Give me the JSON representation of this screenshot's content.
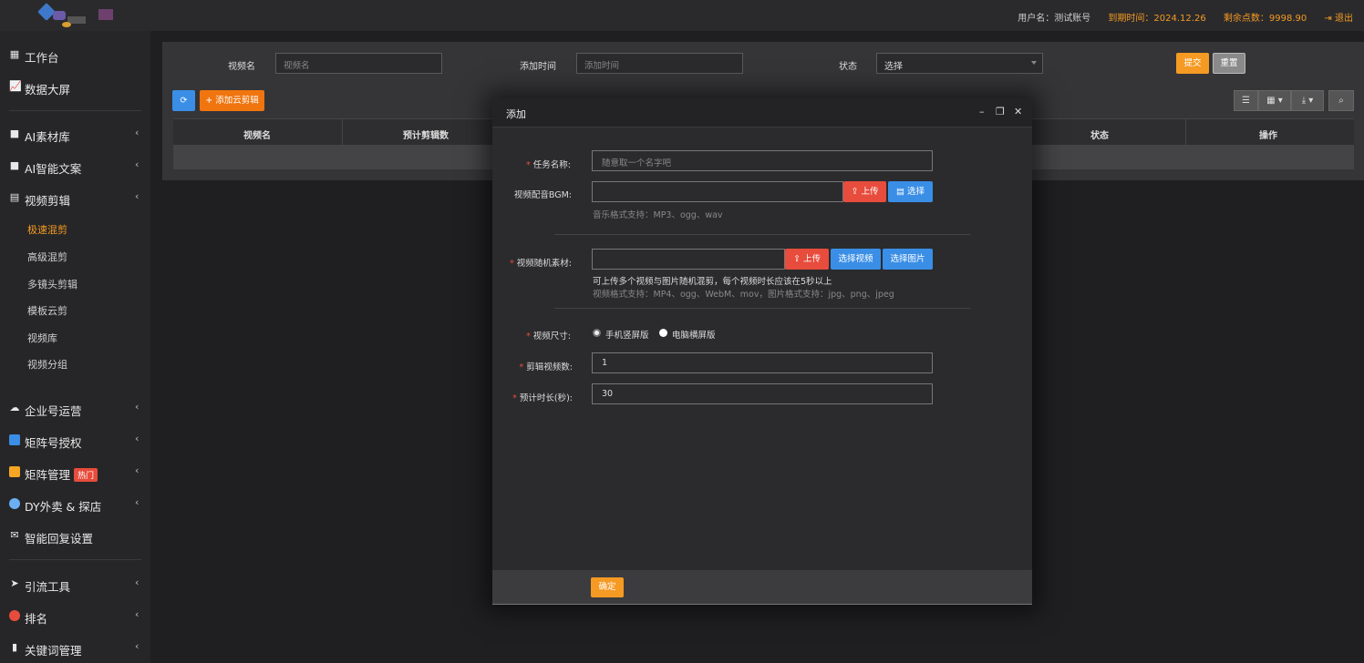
{
  "header": {
    "username_label": "用户名：测试账号",
    "expiry_label": "到期时间：2024.12.26",
    "points_label": "剩余点数：9998.90",
    "logout_label": "退出"
  },
  "sidebar": {
    "items": [
      {
        "label": "工作台"
      },
      {
        "label": "数据大屏"
      },
      {
        "label": "AI素材库"
      },
      {
        "label": "AI智能文案"
      },
      {
        "label": "视频剪辑"
      },
      {
        "label": "企业号运营"
      },
      {
        "label": "矩阵号授权"
      },
      {
        "label": "矩阵管理",
        "badge": "热门"
      },
      {
        "label": "DY外卖 & 探店"
      },
      {
        "label": "智能回复设置"
      },
      {
        "label": "引流工具"
      },
      {
        "label": "排名"
      },
      {
        "label": "关键词管理"
      }
    ],
    "sub_items": [
      {
        "label": "极速混剪"
      },
      {
        "label": "高级混剪"
      },
      {
        "label": "多镜头剪辑"
      },
      {
        "label": "模板云剪"
      },
      {
        "label": "视频库"
      },
      {
        "label": "视频分组"
      }
    ]
  },
  "filter": {
    "video_name_label": "视频名",
    "video_name_placeholder": "视频名",
    "add_time_label": "添加时间",
    "add_time_placeholder": "添加时间",
    "status_label": "状态",
    "status_value": "选择",
    "submit_label": "提交",
    "reset_label": "重置"
  },
  "toolbar": {
    "add_label": "添加云剪辑"
  },
  "table": {
    "columns": [
      "视频名",
      "预计剪辑数",
      "状态",
      "操作"
    ]
  },
  "modal": {
    "title": "添加",
    "task_name_label": "任务名称:",
    "task_name_placeholder": "随意取一个名字吧",
    "bgm_label": "视频配音BGM:",
    "upload_label": "上传",
    "select_label": "选择",
    "bgm_hint": "音乐格式支持：MP3、ogg、wav",
    "material_label": "视频随机素材:",
    "select_video_label": "选择视频",
    "select_image_label": "选择图片",
    "material_hint1": "可上传多个视频与图片随机混剪，每个视频时长应该在5秒以上",
    "material_hint2": "视频格式支持：MP4、ogg、WebM、mov，图片格式支持：jpg、png、jpeg",
    "size_label": "视频尺寸:",
    "size_option1": "手机竖屏版",
    "size_option2": "电脑横屏版",
    "count_label": "剪辑视频数:",
    "count_value": "1",
    "duration_label": "预计时长(秒):",
    "duration_value": "30",
    "confirm_label": "确定"
  }
}
